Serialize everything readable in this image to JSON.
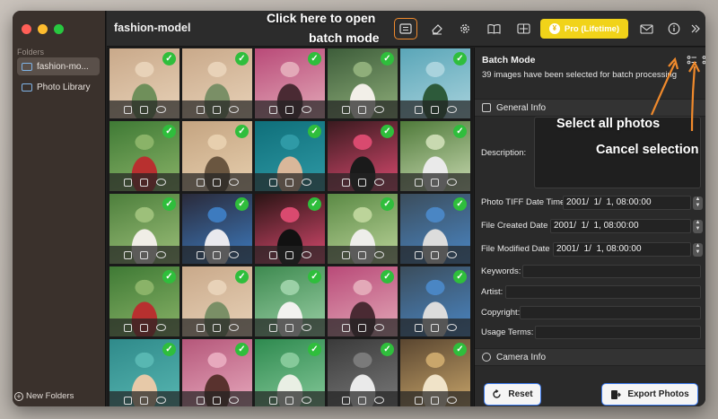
{
  "window": {
    "title": "fashion-model"
  },
  "sidebar": {
    "section_label": "Folders",
    "items": [
      {
        "label": "fashion-mo...",
        "active": true
      },
      {
        "label": "Photo Library",
        "active": false
      }
    ],
    "new_folder_label": "New Folders"
  },
  "toolbar": {
    "icons": [
      "batch-mode-icon",
      "eraser-icon",
      "gear-icon",
      "book-icon",
      "compare-icon",
      "mail-icon",
      "info-icon",
      "chevrons-right-icon"
    ],
    "pro_label": "Pro (Lifetime)",
    "pro_badge": "¥"
  },
  "grid": {
    "rows": 5,
    "cols": 5,
    "all_selected": true,
    "check_glyph": "✓"
  },
  "panel": {
    "title": "Batch Mode",
    "subtitle": "39 images have been selected for batch processing",
    "general_info_label": "General Info",
    "description_label": "Description:",
    "fields": [
      {
        "label": "Photo TIFF Date Time",
        "value": "2001/  1/  1, 08:00:00"
      },
      {
        "label": "File Created Date",
        "value": "2001/  1/  1, 08:00:00"
      },
      {
        "label": "File Modified Date",
        "value": "2001/  1/  1, 08:00:00"
      }
    ],
    "text_fields": [
      {
        "label": "Keywords:"
      },
      {
        "label": "Artist:"
      },
      {
        "label": "Copyright:"
      },
      {
        "label": "Usage Terms:"
      }
    ],
    "camera_info_label": "Camera Info",
    "reset_label": "Reset",
    "export_label": "Export Photos"
  },
  "annotations": {
    "batch_mode_note_line1": "Click here to open",
    "batch_mode_note_line2": "batch mode",
    "select_all_note": "Select all photos",
    "cancel_note": "Cancel selection",
    "arrow_color": "#f08a2c"
  },
  "colors": {
    "accent_orange": "#f08a2c",
    "pro_yellow": "#f1d319",
    "check_green": "#2fbe3c",
    "button_border_blue": "#3d7cf0"
  }
}
